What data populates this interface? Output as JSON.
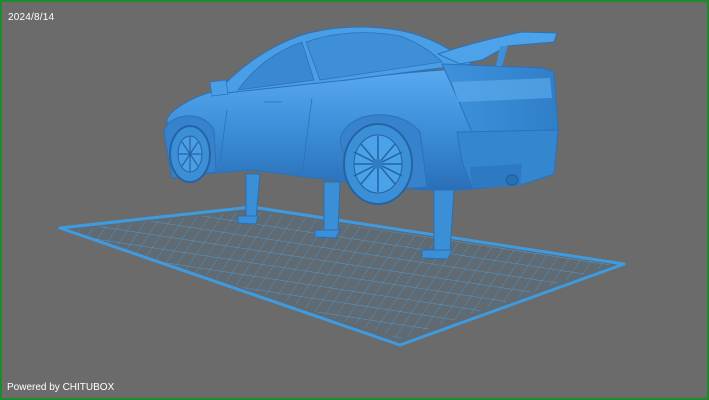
{
  "viewport": {
    "date": "2024/8/14",
    "powered_by": "Powered by CHITUBOX",
    "colors": {
      "background": "#6b6b6b",
      "frame_border": "#1f8a2c",
      "model": "#3a8fd6",
      "build_plate": "#3e9be0",
      "plate_grid": "#4aa2e3"
    },
    "model_name": "sports-sedan-with-rear-wing"
  }
}
